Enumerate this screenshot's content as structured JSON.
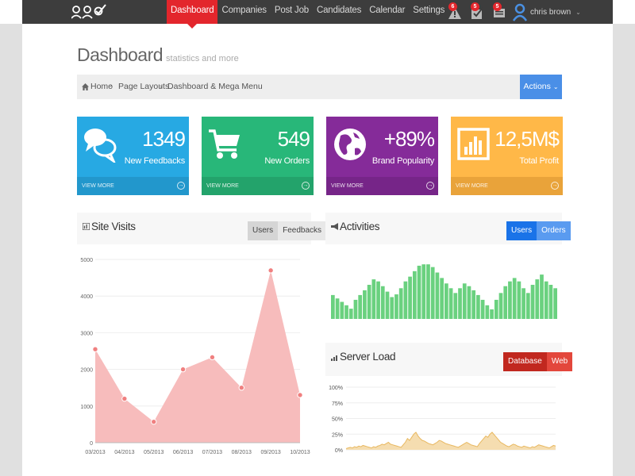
{
  "nav": {
    "items": [
      "Dashboard",
      "Companies",
      "Post Job",
      "Candidates",
      "Calendar",
      "Settings"
    ],
    "active_index": 0
  },
  "notifications": [
    {
      "count": "6",
      "icon": "warning-icon"
    },
    {
      "count": "5",
      "icon": "check-box-icon"
    },
    {
      "count": "5",
      "icon": "chat-icon"
    }
  ],
  "user": {
    "name": "chris brown",
    "icon": "user-icon"
  },
  "page": {
    "title": "Dashboard",
    "subtitle": "statistics and more"
  },
  "breadcrumb": {
    "items": [
      "Home",
      "Page Layouts",
      "Dashboard & Mega Menu"
    ]
  },
  "actions_button": {
    "label": "Actions"
  },
  "stats": [
    {
      "value": "1349",
      "label": "New Feedbacks",
      "footer": "VIEW MORE",
      "color": "#27a9e3",
      "footer_color": "#2297cc",
      "icon": "comments-icon"
    },
    {
      "value": "549",
      "label": "New Orders",
      "footer": "VIEW MORE",
      "color": "#28b779",
      "footer_color": "#23a36b",
      "icon": "cart-icon"
    },
    {
      "value": "+89%",
      "label": "Brand Popularity",
      "footer": "VIEW MORE",
      "color": "#852b99",
      "footer_color": "#762588",
      "icon": "globe-icon"
    },
    {
      "value": "12,5M$",
      "label": "Total Profit",
      "footer": "VIEW MORE",
      "color": "#ffb848",
      "footer_color": "#e9a33a",
      "icon": "bar-chart-icon"
    }
  ],
  "site_visits": {
    "title": "Site Visits",
    "buttons": [
      "Users",
      "Feedbacks"
    ],
    "active_button": 0
  },
  "activities": {
    "title": "Activities",
    "buttons": [
      "Users",
      "Orders"
    ],
    "active_button": 0
  },
  "server_load": {
    "title": "Server Load",
    "buttons": [
      "Database",
      "Web"
    ],
    "active_button": 0
  },
  "chart_data": [
    {
      "type": "area",
      "title": "Site Visits",
      "x": [
        "03/2013",
        "04/2013",
        "05/2013",
        "06/2013",
        "07/2013",
        "08/2013",
        "09/2013",
        "10/2013"
      ],
      "values": [
        2550,
        1200,
        570,
        2000,
        2330,
        1500,
        4700,
        1300
      ],
      "ylim": [
        0,
        5000
      ],
      "yticks": [
        0,
        1000,
        2000,
        3000,
        4000,
        5000
      ],
      "color": "#f7bcbc",
      "point_color": "#f08080",
      "grid": true
    },
    {
      "type": "bar",
      "title": "Activities",
      "values": [
        35,
        30,
        25,
        20,
        15,
        28,
        35,
        42,
        50,
        58,
        55,
        48,
        40,
        32,
        36,
        45,
        55,
        62,
        70,
        78,
        80,
        80,
        76,
        68,
        60,
        52,
        45,
        38,
        45,
        52,
        48,
        42,
        35,
        28,
        20,
        14,
        28,
        38,
        48,
        55,
        60,
        55,
        45,
        38,
        50,
        58,
        65,
        55,
        50,
        45
      ],
      "ylim": [
        0,
        100
      ],
      "color": "#6ad17f"
    },
    {
      "type": "area",
      "title": "Server Load",
      "values": [
        2,
        3,
        4,
        3,
        5,
        4,
        6,
        5,
        7,
        6,
        5,
        4,
        3,
        5,
        4,
        6,
        7,
        9,
        8,
        10,
        12,
        9,
        8,
        7,
        6,
        5,
        4,
        8,
        12,
        18,
        15,
        20,
        25,
        28,
        22,
        18,
        15,
        14,
        12,
        10,
        9,
        8,
        10,
        12,
        15,
        14,
        12,
        10,
        9,
        8,
        7,
        6,
        5,
        4,
        6,
        8,
        10,
        12,
        10,
        8,
        7,
        6,
        5,
        10,
        14,
        18,
        22,
        20,
        25,
        28,
        24,
        20,
        16,
        12,
        10,
        8,
        6,
        5,
        7,
        9,
        8,
        6,
        5,
        4,
        6,
        5,
        4,
        3,
        5,
        4,
        6,
        8,
        7,
        6,
        5,
        4,
        3,
        5,
        7,
        6
      ],
      "ylim": [
        0,
        100
      ],
      "yticks": [
        "0%",
        "25%",
        "50%",
        "75%",
        "100%"
      ],
      "color": "#f5ddb0",
      "line_color": "#e8b860",
      "grid": true
    }
  ]
}
